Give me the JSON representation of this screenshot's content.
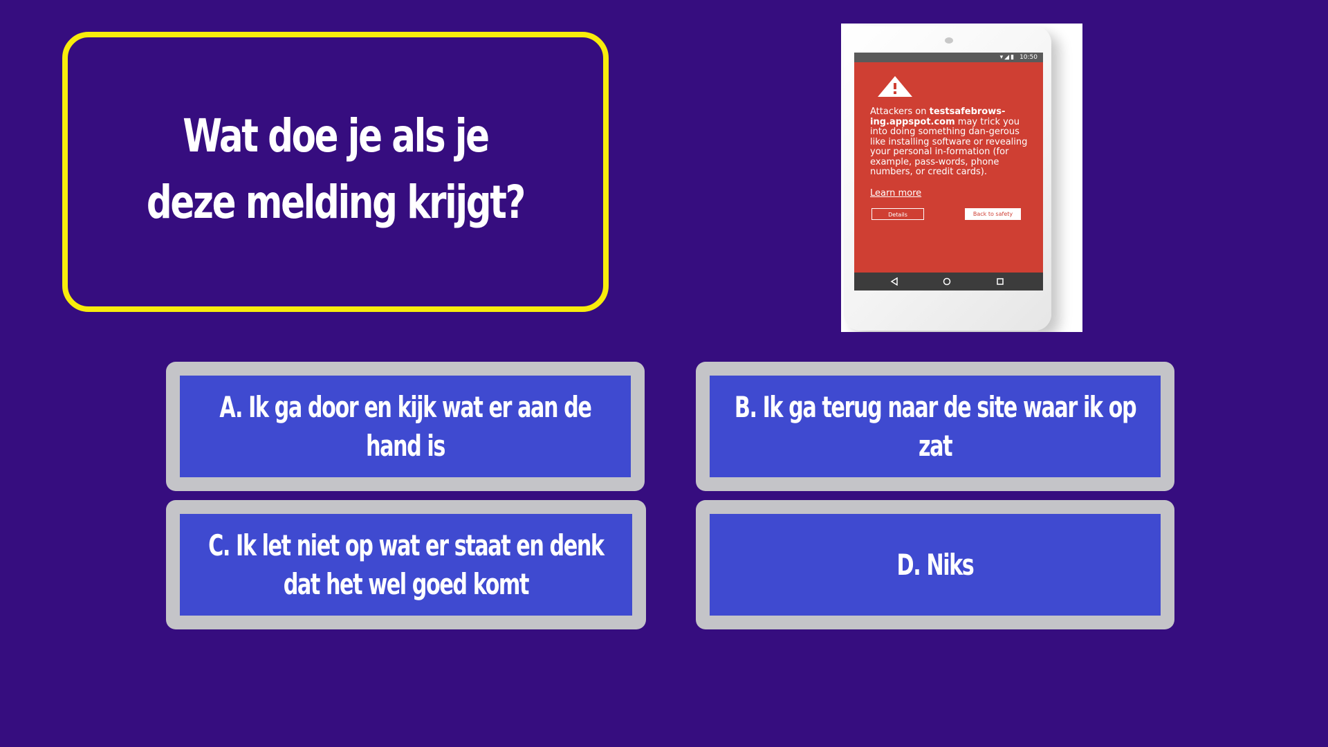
{
  "question": {
    "lines": [
      "Wat doe je als je",
      "deze melding krijgt?"
    ]
  },
  "phone": {
    "status_time": "10:50",
    "warning": {
      "prefix": "Attackers on ",
      "domain": "testsafebrows-ing.appspot.com",
      "body": " may trick you into doing something dan-gerous like installing software or revealing your personal in-formation (for example, pass-words, phone numbers, or credit cards).",
      "learn_more": "Learn more"
    },
    "details_label": "Details",
    "back_to_safety_label": "Back to safety"
  },
  "answers": {
    "a": [
      "A. Ik ga door en kijk wat er aan de",
      "hand is"
    ],
    "b": [
      "B. Ik ga terug naar de site waar ik op",
      "zat"
    ],
    "c": [
      "C. Ik let niet op wat er staat en denk",
      "dat het wel goed komt"
    ],
    "d": [
      "D. Niks"
    ]
  },
  "colors": {
    "background": "#360d7f",
    "question_border": "#f8ec0c",
    "answer_fill": "#3f4ad0",
    "answer_border": "#c4c4c8",
    "warning_red": "#cf3f33"
  }
}
